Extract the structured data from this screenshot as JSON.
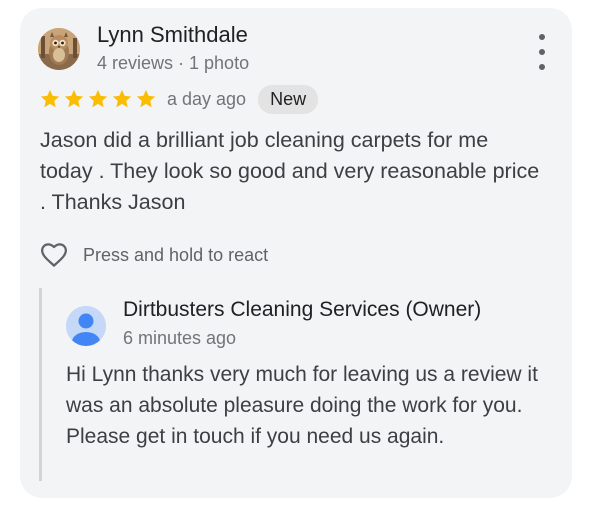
{
  "review": {
    "reviewer_name": "Lynn Smithdale",
    "reviewer_meta": "4 reviews · 1 photo",
    "rating": 5,
    "rating_max": 5,
    "time_ago": "a day ago",
    "badge": "New",
    "text": "Jason did a brilliant job cleaning carpets for me today . They look so good and very reasonable price . Thanks Jason",
    "react_label": "Press and hold to react",
    "more_icon": "more-vert-icon",
    "react_icon": "heart-outline-icon",
    "star_color": "#fbbc04"
  },
  "owner_reply": {
    "owner_name": "Dirtbusters Cleaning Services (Owner)",
    "time_ago": "6 minutes ago",
    "text": "Hi Lynn thanks very much for leaving us a review it was an absolute pleasure doing the work for you. Please get in touch if you need us again.",
    "avatar_icon": "person-icon",
    "avatar_color": "#4285f4"
  }
}
